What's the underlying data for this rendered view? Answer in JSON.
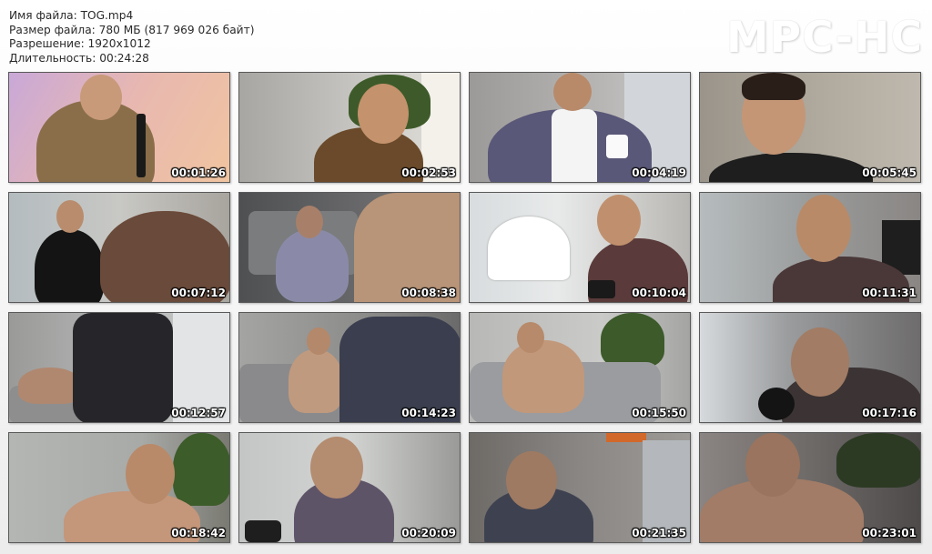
{
  "info": {
    "filename": "Имя файла: TOG.mp4",
    "filesize": "Размер файла: 780 МБ (817 969 026 байт)",
    "resolution": "Разрешение: 1920x1012",
    "duration": "Длительность: 00:24:28"
  },
  "logo": "MPC-HC",
  "thumbnails": [
    {
      "time": "00:01:26"
    },
    {
      "time": "00:02:53"
    },
    {
      "time": "00:04:19"
    },
    {
      "time": "00:05:45"
    },
    {
      "time": "00:07:12"
    },
    {
      "time": "00:08:38"
    },
    {
      "time": "00:10:04"
    },
    {
      "time": "00:11:31"
    },
    {
      "time": "00:12:57"
    },
    {
      "time": "00:14:23"
    },
    {
      "time": "00:15:50"
    },
    {
      "time": "00:17:16"
    },
    {
      "time": "00:18:42"
    },
    {
      "time": "00:20:09"
    },
    {
      "time": "00:21:35"
    },
    {
      "time": "00:23:01"
    }
  ]
}
